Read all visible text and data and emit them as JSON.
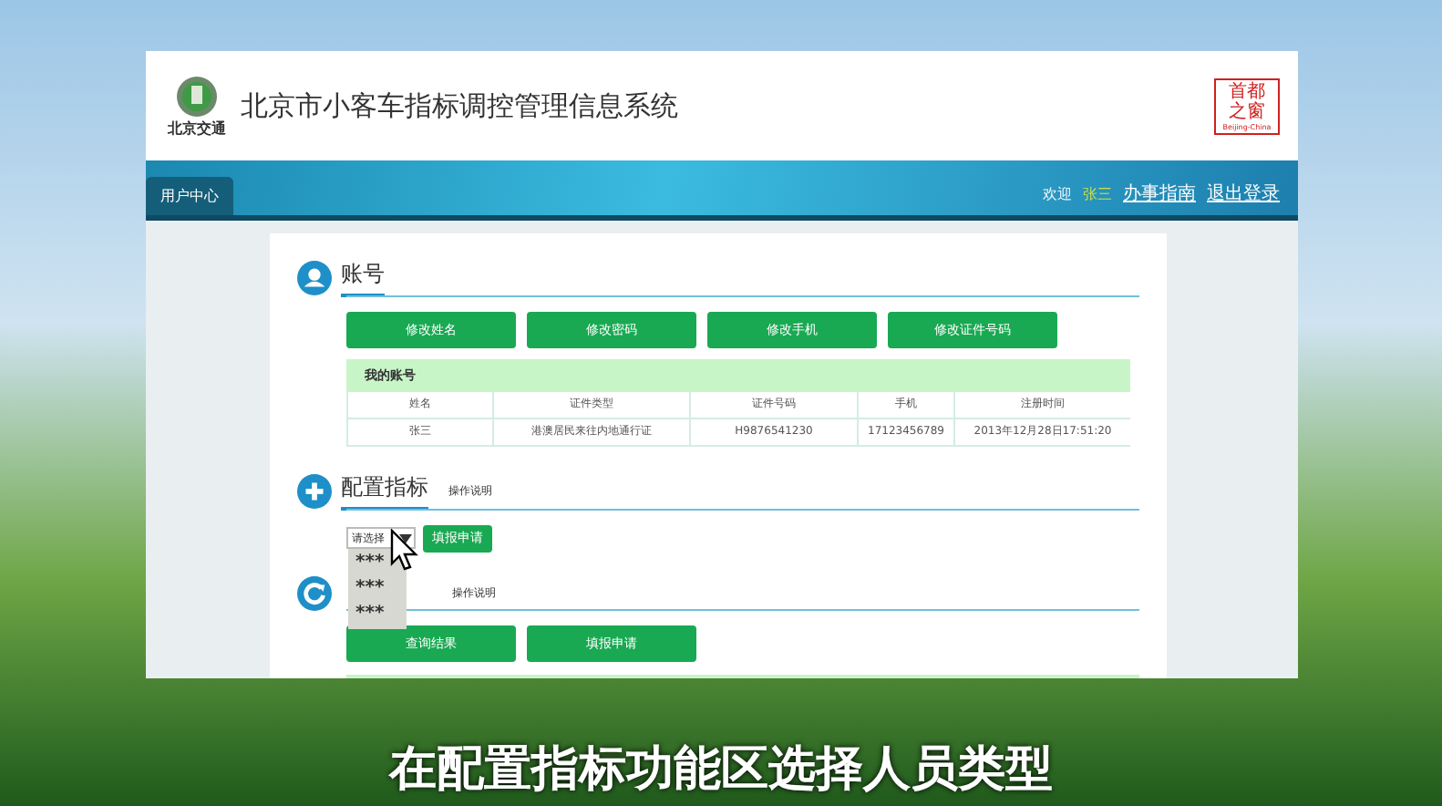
{
  "header": {
    "title": "北京市小客车指标调控管理信息系统",
    "logo_text": "北京交通",
    "seal_text": "首都之窗",
    "seal_caption": "Beijing-China"
  },
  "nav": {
    "tabs": [
      {
        "label": "用户中心",
        "selected": true
      }
    ],
    "welcome": "欢迎",
    "user": "张三",
    "links": [
      "办事指南",
      "退出登录"
    ]
  },
  "sections": [
    {
      "kind": "account",
      "title": "账号",
      "buttons": [
        "修改姓名",
        "修改密码",
        "修改手机",
        "修改证件号码"
      ],
      "table": {
        "caption": "我的账号",
        "columns": [
          "姓名",
          "证件类型",
          "证件号码",
          "手机",
          "注册时间"
        ],
        "rows": [
          [
            "张三",
            "港澳居民来往内地通行证",
            "H9876541230",
            "17123456789",
            "2013年12月28日17:51:20"
          ]
        ]
      }
    },
    {
      "kind": "config",
      "title": "配置指标",
      "note": "操作说明",
      "select": {
        "value": "请选择",
        "expanded": true,
        "options": [
          "***",
          "***",
          "***"
        ]
      },
      "buttons": [
        "填报申请"
      ]
    },
    {
      "kind": "query",
      "note": "操作说明",
      "buttons": [
        "查询结果",
        "填报申请"
      ]
    }
  ],
  "subtitle": "在配置指标功能区选择人员类型"
}
